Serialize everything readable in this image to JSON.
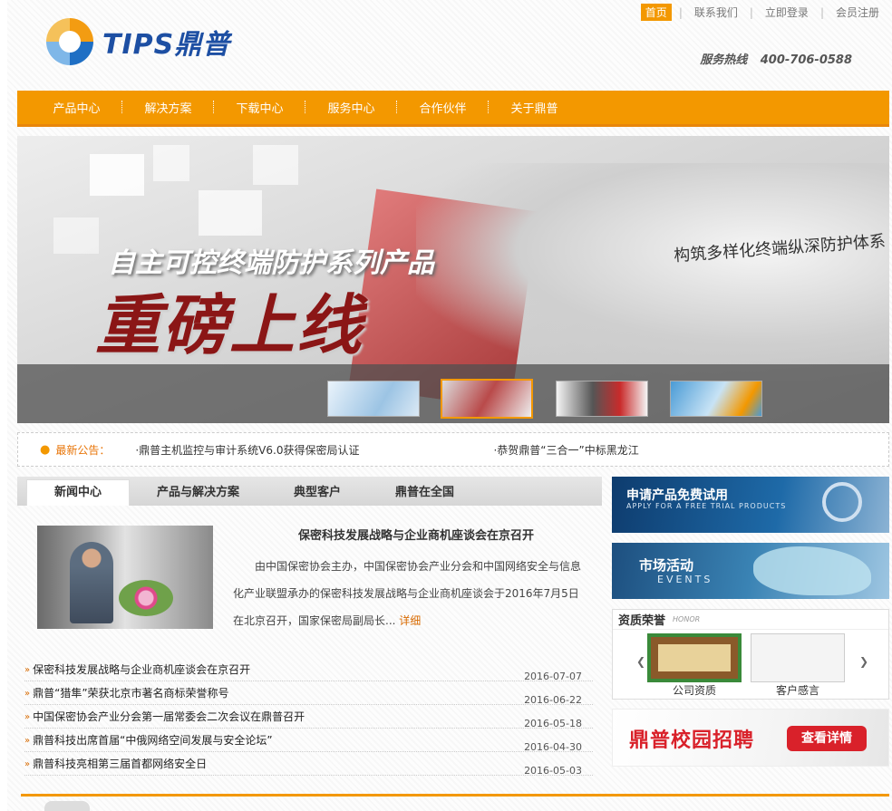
{
  "header": {
    "logo_text": "TIPS鼎普",
    "top_links": [
      "首页",
      "联系我们",
      "立即登录",
      "会员注册"
    ],
    "hotline_label": "服务热线",
    "hotline_number": "400-706-0588"
  },
  "nav": {
    "items": [
      "产品中心",
      "解决方案",
      "下载中心",
      "服务中心",
      "合作伙伴",
      "关于鼎普"
    ]
  },
  "banner": {
    "title": "自主可控终端防护系列产品",
    "big": "重磅上线",
    "subtitle": "构筑多样化终端纵深防护体系",
    "active_thumb": 2
  },
  "notice": {
    "label": "最新公告：",
    "items": [
      "·鼎普主机监控与审计系统V6.0获得保密局认证",
      "·恭贺鼎普“三合一”中标黑龙江"
    ]
  },
  "news": {
    "tabs": [
      "新闻中心",
      "产品与解决方案",
      "典型客户",
      "鼎普在全国"
    ],
    "feature": {
      "title": "保密科技发展战略与企业商机座谈会在京召开",
      "desc": "由中国保密协会主办，中国保密协会产业分会和中国网络安全与信息化产业联盟承办的保密科技发展战略与企业商机座谈会于2016年7月5日在北京召开，国家保密局副局长...",
      "more": "详细"
    },
    "list": [
      {
        "title": "保密科技发展战略与企业商机座谈会在京召开",
        "date": "2016-07-07"
      },
      {
        "title": "鼎普“猎隼”荣获北京市著名商标荣誉称号",
        "date": "2016-06-22"
      },
      {
        "title": "中国保密协会产业分会第一届常委会二次会议在鼎普召开",
        "date": "2016-05-18"
      },
      {
        "title": "鼎普科技出席首届“中俄网络空间发展与安全论坛”",
        "date": "2016-04-30"
      },
      {
        "title": "鼎普科技亮相第三届首都网络安全日",
        "date": "2016-05-03"
      }
    ]
  },
  "right": {
    "trial_title": "申请产品免费试用",
    "trial_en": "APPLY FOR A FREE TRIAL PRODUCTS",
    "events_title": "市场活动",
    "events_en": "EVENTS",
    "honor_title": "资质荣誉",
    "honor_en": "HONOR",
    "honor_captions": [
      "公司资质",
      "客户感言"
    ],
    "campus_title": "鼎普校园招聘",
    "campus_button": "查看详情"
  }
}
